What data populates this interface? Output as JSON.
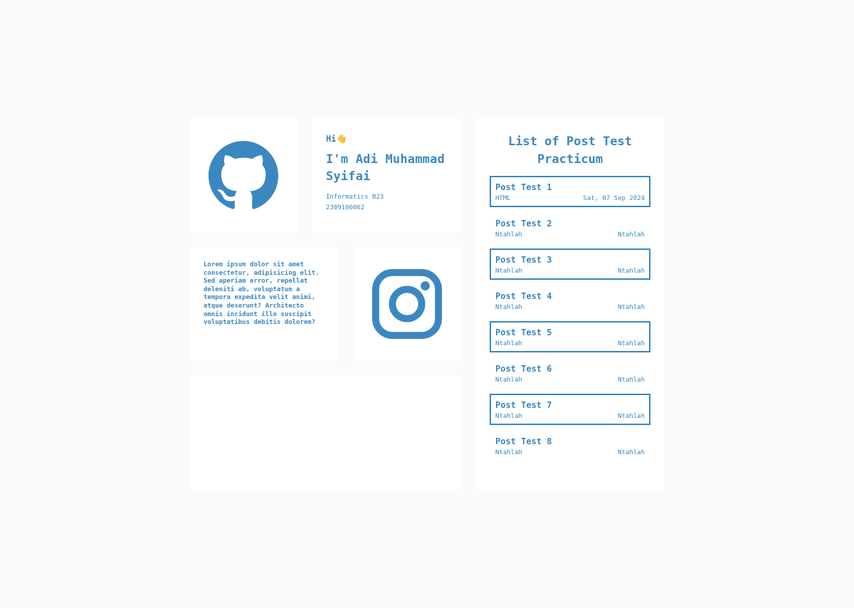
{
  "colors": {
    "accent": "#3b87c0",
    "background": "#f8fafc",
    "card": "#ffffff"
  },
  "icons": {
    "github": "github-icon",
    "instagram": "instagram-icon"
  },
  "intro": {
    "greeting": "Hi👋",
    "name": "I'm Adi Muhammad Syifai",
    "program": "Informatics B23",
    "student_id": "2309106062"
  },
  "about": {
    "text": "Lorem ipsum dolor sit amet consectetur, adipisicing elit. Sed aperiam error, repellat deleniti ab, voluptatum a tempora expedita velit animi, atque deserunt? Architecto omnis incidunt illo suscipit voluptatibus debitis dolorem?"
  },
  "post_list": {
    "title": "List of Post Test Practicum",
    "items": [
      {
        "name": "Post Test 1",
        "topic": "HTML",
        "date": "Sat, 07 Sep 2024"
      },
      {
        "name": "Post Test 2",
        "topic": "Ntahlah",
        "date": "Ntahlah"
      },
      {
        "name": "Post Test 3",
        "topic": "Ntahlah",
        "date": "Ntahlah"
      },
      {
        "name": "Post Test 4",
        "topic": "Ntahlah",
        "date": "Ntahlah"
      },
      {
        "name": "Post Test 5",
        "topic": "Ntahlah",
        "date": "Ntahlah"
      },
      {
        "name": "Post Test 6",
        "topic": "Ntahlah",
        "date": "Ntahlah"
      },
      {
        "name": "Post Test 7",
        "topic": "Ntahlah",
        "date": "Ntahlah"
      },
      {
        "name": "Post Test 8",
        "topic": "Ntahlah",
        "date": "Ntahlah"
      }
    ]
  }
}
